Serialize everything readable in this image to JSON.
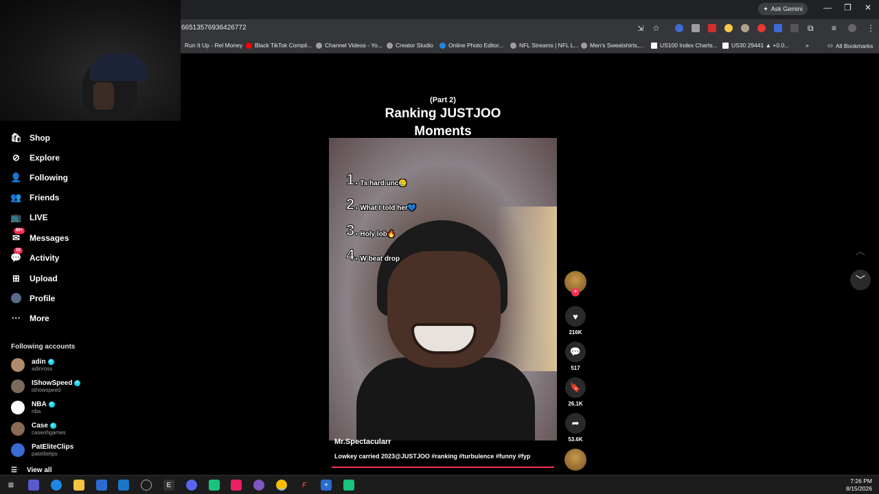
{
  "browser": {
    "url": "665135769364267​72",
    "gemini_label": "Ask Gemini",
    "bookmarks": [
      {
        "label": "Run It Up - Rel Money",
        "color": "#e53935"
      },
      {
        "label": "Black TikTok Compil...",
        "color": "#ff0000"
      },
      {
        "label": "Channel Videos - Yo...",
        "color": "#9e9e9e"
      },
      {
        "label": "Creator Studio",
        "color": "#9e9e9e"
      },
      {
        "label": "Online Photo Editor...",
        "color": "#1e88e5"
      },
      {
        "label": "NFL Streams | NFL L...",
        "color": "#9e9e9e"
      },
      {
        "label": "Men's Sweatshirts,...",
        "color": "#9e9e9e"
      },
      {
        "label": "US100 Index Charts...",
        "color": "#ffffff"
      },
      {
        "label": "US30 29441 ▲ +0.0...",
        "color": "#ffffff"
      }
    ],
    "all_bookmarks": "All Bookmarks"
  },
  "sidebar": {
    "items": [
      {
        "label": "Shop",
        "icon": "shop-icon"
      },
      {
        "label": "Explore",
        "icon": "compass-icon"
      },
      {
        "label": "Following",
        "icon": "following-icon"
      },
      {
        "label": "Friends",
        "icon": "friends-icon"
      },
      {
        "label": "LIVE",
        "icon": "live-icon"
      },
      {
        "label": "Messages",
        "icon": "messages-icon",
        "badge": "99+"
      },
      {
        "label": "Activity",
        "icon": "activity-icon",
        "badge": "18"
      },
      {
        "label": "Upload",
        "icon": "upload-icon"
      },
      {
        "label": "Profile",
        "icon": "profile-icon"
      },
      {
        "label": "More",
        "icon": "more-icon"
      }
    ],
    "following_title": "Following accounts",
    "accounts": [
      {
        "name": "adin",
        "handle": "adinross",
        "color": "#b08a6a"
      },
      {
        "name": "IShowSpeed",
        "handle": "ishowspeed",
        "color": "#7a6a5a"
      },
      {
        "name": "NBA",
        "handle": "nba",
        "color": "#ffffff"
      },
      {
        "name": "Case",
        "handle": "caseohgames",
        "color": "#8a6a55"
      },
      {
        "name": "PatEliteClips",
        "handle": "patelitelips",
        "color": "#3a6ad4"
      }
    ],
    "view_all": "View all"
  },
  "video": {
    "part": "(Part 2)",
    "title_line1": "Ranking JUSTJOO",
    "title_line2": "Moments",
    "rankings": [
      {
        "num": "1.",
        "text": "Ts hard unc🥲"
      },
      {
        "num": "2.",
        "text": "What I told her💙"
      },
      {
        "num": "3.",
        "text": "Holy lob🔥"
      },
      {
        "num": "4.",
        "text": "W beat drop"
      }
    ],
    "author": "Mr.Spectacularr",
    "description": "Lowkey carried 2023@JUSTJOO #ranking #turbulence #funny #fyp"
  },
  "actions": {
    "likes": "216K",
    "comments": "517",
    "saves": "26.1K",
    "shares": "53.6K"
  },
  "taskbar": {
    "time": "7:26 PM",
    "date": "8/15/2026"
  }
}
